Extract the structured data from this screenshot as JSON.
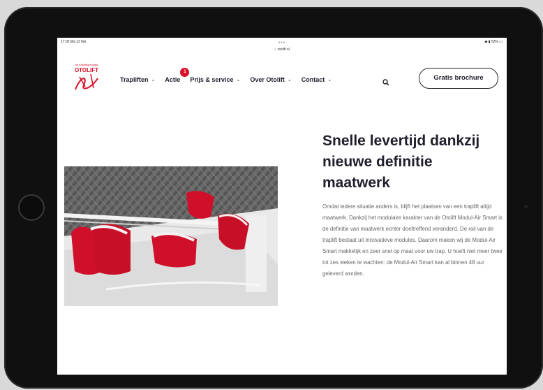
{
  "status_bar": {
    "time": "17:02  Ma 12 feb.",
    "battery": "◆ ▮ 52% ▭"
  },
  "browser": {
    "url": "⌂ otolift.nl",
    "dots": "•••"
  },
  "logo": {
    "tagline": "de trapliftspecialist",
    "brand": "OTOLIFT"
  },
  "nav": {
    "items": [
      {
        "label": "Trapliften",
        "chevron": "⌄"
      },
      {
        "label": "Actie",
        "badge": "1"
      },
      {
        "label": "Prijs & service",
        "chevron": "⌄"
      },
      {
        "label": "Over Otolift",
        "chevron": "⌄"
      },
      {
        "label": "Contact",
        "chevron": "⌄"
      }
    ],
    "cta_label": "Gratis brochure"
  },
  "content": {
    "heading": "Snelle levertijd dankzij nieuwe definitie maatwerk",
    "paragraph": "Omdat iedere situatie anders is, blijft het plaatsen van een traplift altijd maatwerk. Dankzij het modulaire karakter van de Otolift Modul-Air Smart is de definitie van maatwerk echter doeltreffend veranderd. De rail van de traplift bestaat uit innovatieve modules. Daarom maken wij de Modul-Air Smart makkelijk en zeer snel op maat voor uw trap. U hoeft niet meer twee tot zes weken te wachten: de Modul-Air Smart kan al binnen 48 uur geleverd worden."
  },
  "colors": {
    "brand_red": "#d8102a",
    "text_dark": "#1e1e2c",
    "text_body": "#666666"
  }
}
